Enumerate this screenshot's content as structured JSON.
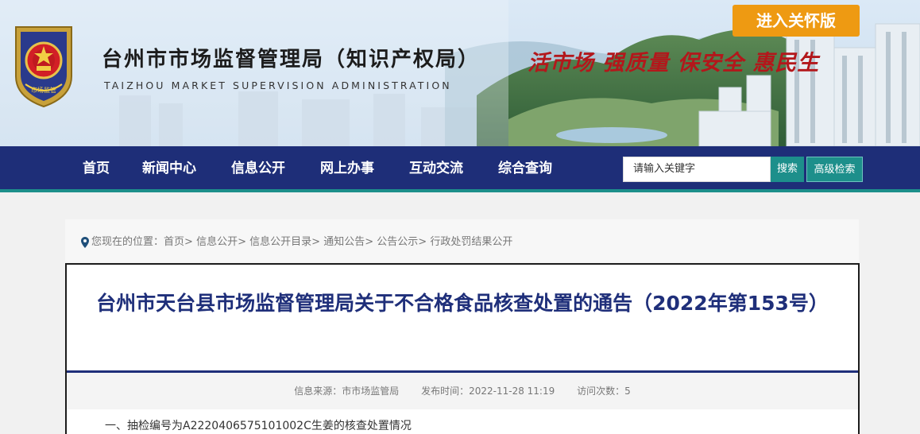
{
  "header": {
    "care_mode_label": "进入关怀版",
    "title_cn": "台州市市场监督管理局（知识产权局）",
    "title_en": "TAIZHOU MARKET SUPERVISION ADMINISTRATION",
    "slogan": "活市场  强质量  保安全  惠民生",
    "emblem_text": "市场监管",
    "emblem_icon": "market-supervision-emblem"
  },
  "nav": {
    "items": [
      "首页",
      "新闻中心",
      "信息公开",
      "网上办事",
      "互动交流",
      "综合查询"
    ],
    "search_placeholder": "请输入关键字",
    "search_label": "搜索",
    "advanced_search_label": "高级检索"
  },
  "breadcrumb": {
    "icon": "location-pin-icon",
    "prefix": "您现在的位置：",
    "items": [
      "首页",
      "信息公开",
      "信息公开目录",
      "通知公告",
      "公告公示",
      "行政处罚结果公开"
    ],
    "separator": ">"
  },
  "article": {
    "title": "台州市天台县市场监督管理局关于不合格食品核查处置的通告（2022年第153号）",
    "source": "信息来源：市市场监管局",
    "publish_time": "发布时间：2022-11-28 11:19",
    "views": "访问次数：5",
    "first_line": "一、抽检编号为A2220406575101002C生姜的核查处置情况"
  },
  "colors": {
    "nav_bg": "#1e2e78",
    "accent_teal": "#1d8f8b",
    "care_button": "#ee9a12",
    "slogan_red": "#b3171b",
    "title_blue": "#1f2f7a"
  }
}
